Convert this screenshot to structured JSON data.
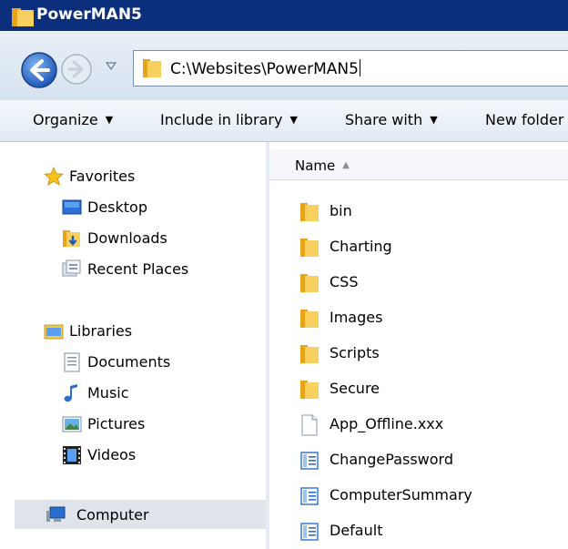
{
  "window": {
    "title": "PowerMAN5"
  },
  "navigation": {
    "address": "C:\\Websites\\PowerMAN5"
  },
  "toolbar": {
    "organize": "Organize",
    "include_in_library": "Include in library",
    "share_with": "Share with",
    "new_folder": "New folder"
  },
  "nav_pane": {
    "favorites": {
      "label": "Favorites",
      "icon": "star-icon"
    },
    "favorite_items": [
      {
        "label": "Desktop",
        "icon": "desktop-icon"
      },
      {
        "label": "Downloads",
        "icon": "downloads-folder-icon"
      },
      {
        "label": "Recent Places",
        "icon": "recent-places-icon"
      }
    ],
    "libraries": {
      "label": "Libraries",
      "icon": "libraries-icon"
    },
    "library_items": [
      {
        "label": "Documents",
        "icon": "documents-icon"
      },
      {
        "label": "Music",
        "icon": "music-note-icon"
      },
      {
        "label": "Pictures",
        "icon": "pictures-icon"
      },
      {
        "label": "Videos",
        "icon": "video-film-icon"
      }
    ],
    "computer": {
      "label": "Computer",
      "icon": "computer-icon"
    }
  },
  "file_list": {
    "column_name": "Name",
    "sort": "ascending",
    "items": [
      {
        "name": "bin",
        "type": "folder"
      },
      {
        "name": "Charting",
        "type": "folder"
      },
      {
        "name": "CSS",
        "type": "folder"
      },
      {
        "name": "Images",
        "type": "folder"
      },
      {
        "name": "Scripts",
        "type": "folder"
      },
      {
        "name": "Secure",
        "type": "folder"
      },
      {
        "name": "App_Offline.xxx",
        "type": "file"
      },
      {
        "name": "ChangePassword",
        "type": "aspx"
      },
      {
        "name": "ComputerSummary",
        "type": "aspx"
      },
      {
        "name": "Default",
        "type": "aspx"
      }
    ]
  },
  "colors": {
    "titlebar": "#0b2f7d",
    "folder": "#f0c040",
    "back_button": "#2a6fd0"
  }
}
